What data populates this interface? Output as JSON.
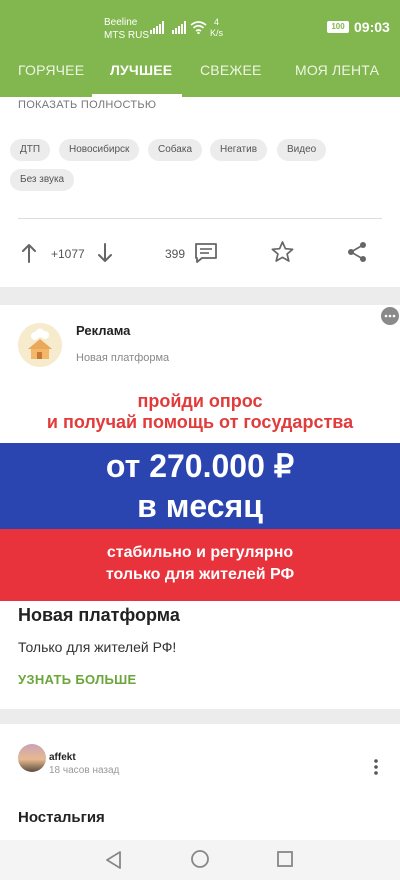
{
  "status_bar": {
    "carrier": "Beeline",
    "carrier2": "MTS RUS",
    "speed_value": "4",
    "speed_unit": "K/s",
    "battery": "100",
    "time": "09:03"
  },
  "tabs": [
    {
      "label": "ГОРЯЧЕЕ"
    },
    {
      "label": "ЛУЧШЕЕ",
      "active": true
    },
    {
      "label": "СВЕЖЕЕ"
    },
    {
      "label": "МОЯ ЛЕНТА"
    }
  ],
  "post": {
    "show_more": "ПОКАЗАТЬ ПОЛНОСТЬЮ",
    "tags": [
      "ДТП",
      "Новосибирск",
      "Собака",
      "Негатив",
      "Видео",
      "Без звука"
    ],
    "rating": "+1077",
    "comments": "399"
  },
  "ad": {
    "title": "Реклама",
    "subtitle": "Новая платформа",
    "banner_line1": "пройди опрос",
    "banner_line2": "и получай помощь от государства",
    "banner_amount": "от 270.000 ₽",
    "banner_period": "в месяц",
    "banner_red1": "стабильно и регулярно",
    "banner_red2": "только для жителей РФ",
    "headline": "Новая платформа",
    "body": "Только для жителей РФ!",
    "cta": "УЗНАТЬ БОЛЬШЕ"
  },
  "next_post": {
    "username": "affekt",
    "time": "18 часов назад",
    "title": "Ностальгия"
  },
  "colors": {
    "header": "#82b64e",
    "accent_text": "#6aa63a",
    "flag_blue": "#2a45b0",
    "flag_red": "#e8323c"
  }
}
